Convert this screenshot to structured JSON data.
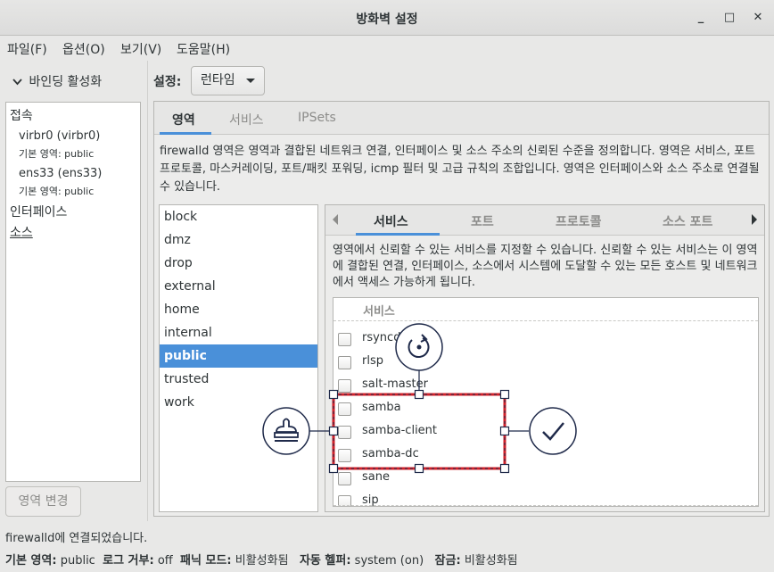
{
  "window": {
    "title": "방화벽 설정",
    "controls": {
      "minimize": "_",
      "maximize": "□",
      "close": "✕"
    }
  },
  "menu": [
    "파일(F)",
    "옵션(O)",
    "보기(V)",
    "도움말(H)"
  ],
  "left": {
    "binding_toggle": "바인딩 활성화",
    "section_connections": "접속",
    "connections": [
      {
        "name": "virbr0 (virbr0)",
        "zone": "기본 영역: public"
      },
      {
        "name": "ens33 (ens33)",
        "zone": "기본 영역: public"
      }
    ],
    "section_interfaces": "인터페이스",
    "section_sources": "소스",
    "change_zone_button": "영역 변경"
  },
  "config": {
    "label": "설정:",
    "value": "런타임"
  },
  "tabs": [
    "영역",
    "서비스",
    "IPSets"
  ],
  "zones_description": "firewalld 영역은 영역과 결합된 네트워크 연결, 인터페이스 및 소스 주소의 신뢰된 수준을 정의합니다. 영역은 서비스, 포트 프로토콜, 마스커레이딩, 포트/패킷 포워딩, icmp 필터 및 고급 규칙의 조합입니다. 영역은 인터페이스와 소스 주소로 연결될 수 있습니다.",
  "zones": [
    "block",
    "dmz",
    "drop",
    "external",
    "home",
    "internal",
    "public",
    "trusted",
    "work"
  ],
  "selected_zone": "public",
  "inner_tabs": [
    "서비스",
    "포트",
    "프로토콜",
    "소스 포트"
  ],
  "services_description": "영역에서 신뢰할 수 있는 서비스를 지정할 수 있습니다. 신뢰할 수 있는 서비스는 이 영역에 결합된 연결, 인터페이스, 소스에서 시스템에 도달할 수 있는 모든 호스트 및 네트워크에서 액세스 가능하게 됩니다.",
  "services_column": "서비스",
  "services": [
    {
      "name": "rsyncd",
      "checked": false
    },
    {
      "name": "rlsp",
      "checked": false
    },
    {
      "name": "salt-master",
      "checked": false
    },
    {
      "name": "samba",
      "checked": false
    },
    {
      "name": "samba-client",
      "checked": false
    },
    {
      "name": "samba-dc",
      "checked": false
    },
    {
      "name": "sane",
      "checked": false
    },
    {
      "name": "sip",
      "checked": false
    }
  ],
  "status": {
    "connection": "firewalld에 연결되었습니다.",
    "default_zone_label": "기본 영역:",
    "default_zone_value": "public",
    "log_denied_label": "로그 거부:",
    "log_denied_value": "off",
    "panic_label": "패닉 모드:",
    "panic_value": "비활성화됨",
    "helper_label": "자동 헬퍼:",
    "helper_value": "system (on)",
    "lockdown_label": "잠금:",
    "lockdown_value": "비활성화됨"
  },
  "colors": {
    "accent": "#4a90d9",
    "selection_highlight": "#d0202a",
    "overlay_navy": "#1f2a4a"
  },
  "overlay_icons": [
    "rotate-icon",
    "stamp-icon",
    "checkmark-icon"
  ]
}
